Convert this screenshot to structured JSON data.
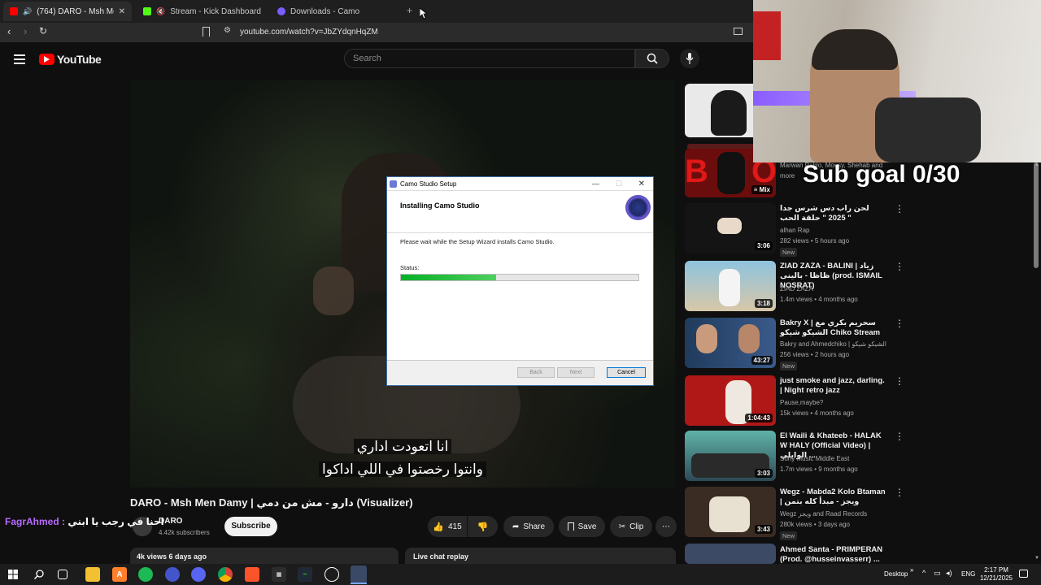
{
  "browser": {
    "tabs": [
      {
        "label": "(764) DARO - Msh Men Damy"
      },
      {
        "label": "Stream - Kick Dashboard"
      },
      {
        "label": "Downloads - Camo"
      }
    ],
    "url": "youtube.com/watch?v=JbZYdqnHqZM"
  },
  "youtube": {
    "logo_text": "YouTube",
    "search_placeholder": "Search",
    "subtitle_line1": "انا اتعودت اداري",
    "subtitle_line2": "وانتوا رخصتوا في اللي اداكوا",
    "video_title": "DARO - Msh Men Damy | دارو - مش من دمي (Visualizer)",
    "channel_name": "DARO",
    "subscribers": "4.42k subscribers",
    "subscribe_label": "Subscribe",
    "like_count": "415",
    "share_label": "Share",
    "save_label": "Save",
    "clip_label": "Clip",
    "views_date": "4k views  6 days ago",
    "live_chat_label": "Live chat replay"
  },
  "installer": {
    "window_title": "Camo Studio Setup",
    "heading": "Installing Camo Studio",
    "message": "Please wait while the Setup Wizard installs Camo Studio.",
    "status_label": "Status:",
    "progress_percent": 40,
    "back_label": "Back",
    "next_label": "Next",
    "cancel_label": "Cancel"
  },
  "stream_overlay": {
    "sub_goal": "Sub goal 0/30",
    "chat_name": "FagrAhmed :",
    "chat_message": "احنا في رجب يا ابني"
  },
  "sidebar": {
    "partial_meta": "Marwan Pablo, Mousy, Shehab and more",
    "mix_label": "Mix",
    "videos": [
      {
        "title": "لحن راب دس شرس جدا 2025 \" حلقة الحب \"",
        "channel": "alhan Rap",
        "views": "282 views • 5 hours ago",
        "duration": "3:06",
        "badge": "New"
      },
      {
        "title": "ZIAD ZAZA - BALINI | زياد ظاظا - بالينى (prod. ISMAIL NOSRAT)",
        "channel": "ZIAD ZAZA",
        "views": "1.4m views • 4 months ago",
        "duration": "3:18",
        "badge": ""
      },
      {
        "title": "Bakry X | سحريم بكري مع الشيكو شيكو Chiko Stream",
        "channel": "Bakry and Ahmedchiko | الشيكو شيكو",
        "views": "256 views • 2 hours ago",
        "duration": "43:27",
        "badge": "New"
      },
      {
        "title": "just smoke and jazz, darling. | Night retro jazz",
        "channel": "Pause,maybe?",
        "views": "15k views • 4 months ago",
        "duration": "1:04:43",
        "badge": ""
      },
      {
        "title": "El Waili & Khateeb - HALAK W HALY (Official Video) | الوايلي ...",
        "channel": "Sony Music Middle East",
        "views": "1.7m views • 9 months ago",
        "duration": "3:03",
        "badge": ""
      },
      {
        "title": "Wegz - Mabda2 Kolo Btaman | ويجز - مبدأ كله بتمن",
        "channel": "Wegz ويجز and Raad Records",
        "views": "280k views • 3 days ago",
        "duration": "3:43",
        "badge": "New"
      },
      {
        "title": "Ahmed Santa - PRIMPERAN (Prod. @husseinvasserr) ...",
        "channel": "",
        "views": "",
        "duration": "",
        "badge": ""
      }
    ]
  },
  "taskbar": {
    "desktop_label": "Desktop",
    "language": "ENG",
    "time": "2:17 PM",
    "date": "12/21/2025"
  }
}
